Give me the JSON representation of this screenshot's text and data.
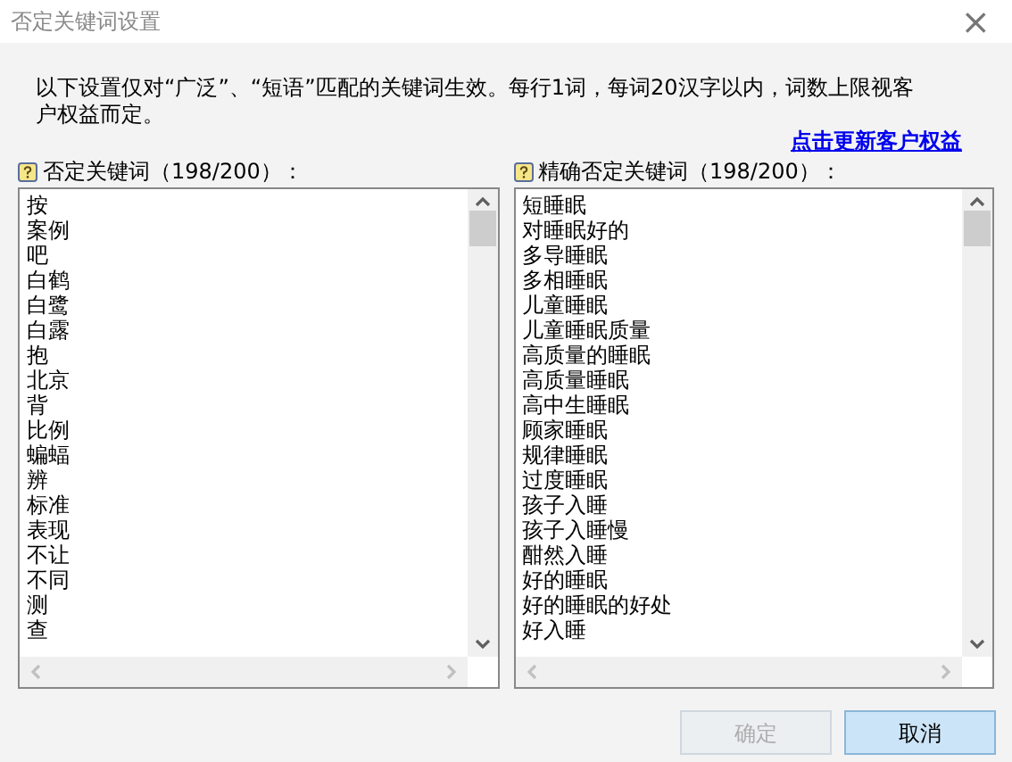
{
  "window": {
    "title": "否定关键词设置",
    "close": "×"
  },
  "notice": "以下设置仅对“广泛”、“短语”匹配的关键词生效。每行1词，每词20汉字以内，词数上限视客户权益而定。",
  "update_link": "点击更新客户权益",
  "lists": [
    {
      "label": "否定关键词（198/200）：",
      "items": [
        "按",
        "案例",
        "吧",
        "白鹤",
        "白鹭",
        "白露",
        "抱",
        "北京",
        "背",
        "比例",
        "蝙蝠",
        "辨",
        "标准",
        "表现",
        "不让",
        "不同",
        "测",
        "查"
      ]
    },
    {
      "label": "精确否定关键词（198/200）：",
      "items": [
        "短睡眠",
        "对睡眠好的",
        "多导睡眠",
        "多相睡眠",
        "儿童睡眠",
        "儿童睡眠质量",
        "高质量的睡眠",
        "高质量睡眠",
        "高中生睡眠",
        "顾家睡眠",
        "规律睡眠",
        "过度睡眠",
        "孩子入睡",
        "孩子入睡慢",
        "酣然入睡",
        "好的睡眠",
        "好的睡眠的好处",
        "好入睡"
      ]
    }
  ],
  "buttons": [
    {
      "label": "确定",
      "disabled": true
    },
    {
      "label": "取消",
      "disabled": false
    }
  ]
}
